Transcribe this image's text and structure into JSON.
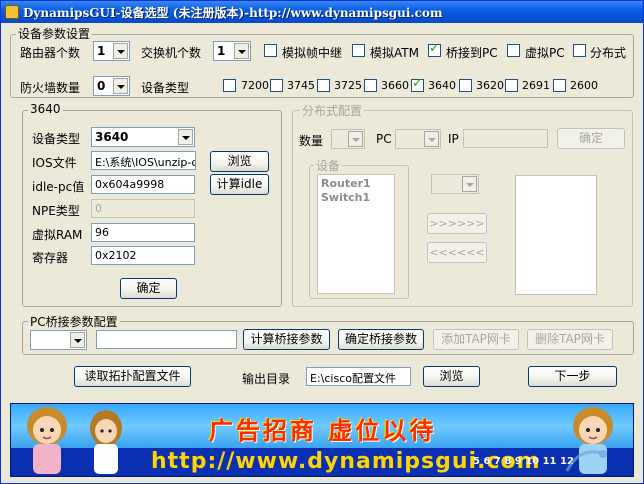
{
  "window": {
    "title": "DynamipsGUI-设备选型 (未注册版本)-http://www.dynamipsgui.com"
  },
  "device_params": {
    "group_title": "设备参数设置",
    "router_count_label": "路由器个数",
    "router_count_value": "1",
    "switch_count_label": "交换机个数",
    "switch_count_value": "1",
    "options": [
      {
        "label": "模拟帧中继",
        "checked": false
      },
      {
        "label": "模拟ATM",
        "checked": false
      },
      {
        "label": "桥接到PC",
        "checked": true
      },
      {
        "label": "虚拟PC",
        "checked": false
      },
      {
        "label": "分布式",
        "checked": false
      }
    ],
    "firewall_count_label": "防火墙数量",
    "firewall_count_value": "0",
    "device_type_label": "设备类型",
    "device_types": [
      {
        "label": "7200",
        "checked": false
      },
      {
        "label": "3745",
        "checked": false
      },
      {
        "label": "3725",
        "checked": false
      },
      {
        "label": "3660",
        "checked": false
      },
      {
        "label": "3640",
        "checked": true
      },
      {
        "label": "3620",
        "checked": false
      },
      {
        "label": "2691",
        "checked": false
      },
      {
        "label": "2600",
        "checked": false
      }
    ]
  },
  "model_panel": {
    "group_title": "3640",
    "device_type_label": "设备类型",
    "device_type_value": "3640",
    "ios_label": "IOS文件",
    "ios_value": "E:\\系统\\IOS\\unzip-c",
    "browse_label": "浏览",
    "idlepc_label": "idle-pc值",
    "idlepc_value": "0x604a9998",
    "calc_idle_label": "计算idle",
    "npe_label": "NPE类型",
    "npe_value": "0",
    "ram_label": "虚拟RAM",
    "ram_value": "96",
    "register_label": "寄存器",
    "register_value": "0x2102",
    "confirm_label": "确定"
  },
  "distributed": {
    "group_title": "分布式配置",
    "count_label": "数量",
    "pc_label": "PC",
    "ip_label": "IP",
    "confirm_label": "确定",
    "devices_title": "设备",
    "devices": [
      "Router1",
      "Switch1"
    ],
    "move_right_label": ">>>>>>",
    "move_left_label": "<<<<<<"
  },
  "bridge": {
    "group_title": "PC桥接参数配置",
    "calc_label": "计算桥接参数",
    "confirm_label": "确定桥接参数",
    "add_tap_label": "添加TAP网卡",
    "del_tap_label": "删除TAP网卡"
  },
  "bottom": {
    "read_topology_label": "读取拓扑配置文件",
    "output_dir_label": "输出目录",
    "output_dir_value": "E:\\cisco配置文件",
    "browse_label": "浏览",
    "next_label": "下一步"
  },
  "banner": {
    "ad_text": "广告招商 虚位以待",
    "url_text": "http://www.dynamipsgui.com",
    "pager_text": "5 6 7 8 9 10 11 12"
  },
  "colors": {
    "title_bar": "#0a5ee8",
    "window_bg": "#ece9d8",
    "banner_bg": "#0a2fb0",
    "banner_ad": "#ff2a00",
    "banner_url": "#ffd400"
  }
}
